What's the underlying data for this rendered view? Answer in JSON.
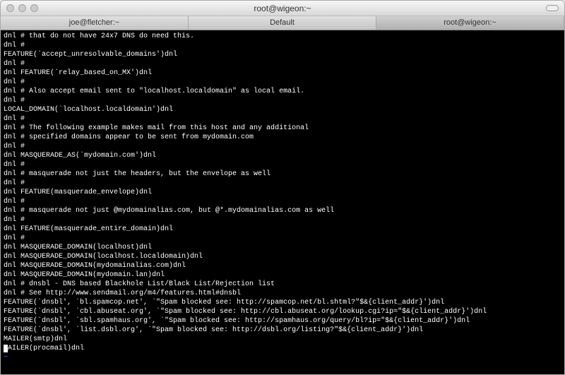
{
  "window": {
    "title": "root@wigeon:~"
  },
  "tabs": [
    {
      "label": "joe@fletcher:~",
      "active": false
    },
    {
      "label": "Default",
      "active": false
    },
    {
      "label": "root@wigeon:~",
      "active": true
    }
  ],
  "terminal_lines": [
    "dnl # that do not have 24x7 DNS do need this.",
    "dnl #",
    "FEATURE(`accept_unresolvable_domains')dnl",
    "dnl #",
    "dnl FEATURE(`relay_based_on_MX')dnl",
    "dnl #",
    "dnl # Also accept email sent to \"localhost.localdomain\" as local email.",
    "dnl #",
    "LOCAL_DOMAIN(`localhost.localdomain')dnl",
    "dnl #",
    "dnl # The following example makes mail from this host and any additional",
    "dnl # specified domains appear to be sent from mydomain.com",
    "dnl #",
    "dnl MASQUERADE_AS(`mydomain.com')dnl",
    "dnl #",
    "dnl # masquerade not just the headers, but the envelope as well",
    "dnl #",
    "dnl FEATURE(masquerade_envelope)dnl",
    "dnl #",
    "dnl # masquerade not just @mydomainalias.com, but @*.mydomainalias.com as well",
    "dnl #",
    "dnl FEATURE(masquerade_entire_domain)dnl",
    "dnl #",
    "dnl MASQUERADE_DOMAIN(localhost)dnl",
    "dnl MASQUERADE_DOMAIN(localhost.localdomain)dnl",
    "dnl MASQUERADE_DOMAIN(mydomainalias.com)dnl",
    "dnl MASQUERADE_DOMAIN(mydomain.lan)dnl",
    "dnl # dnsbl - DNS based Blackhole List/Black List/Rejection list",
    "dnl # See http://www.sendmail.org/m4/features.html#dnsbl",
    "FEATURE(`dnsbl', `bl.spamcop.net', `\"Spam blocked see: http://spamcop.net/bl.shtml?\"$&{client_addr}')dnl",
    "FEATURE(`dnsbl', `cbl.abuseat.org', `\"Spam blocked see: http://cbl.abuseat.org/lookup.cgi?ip=\"$&{client_addr}')dnl",
    "FEATURE(`dnsbl', `sbl.spamhaus.org', `\"Spam blocked see: http://spamhaus.org/query/bl?ip=\"$&{client_addr}')dnl",
    "FEATURE(`dnsbl', `list.dsbl.org', `\"Spam blocked see: http://dsbl.org/listing?\"$&{client_addr}')dnl",
    "MAILER(smtp)dnl"
  ],
  "cursor_line_text": "AILER(procmail)dnl",
  "cursor_prefix": "M",
  "tilde": "~"
}
